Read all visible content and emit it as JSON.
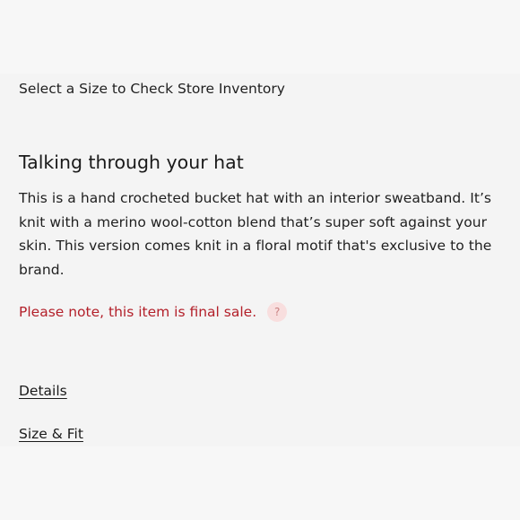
{
  "store_inventory_label": "Select a Size to Check Store Inventory",
  "section_title": "Talking through your hat",
  "description": "This is a hand crocheted bucket hat with an interior sweatband. It’s knit with a merino wool-cotton blend that’s super soft against your skin. This version comes knit in a floral motif that's exclusive to the brand.",
  "final_sale_note": "Please note, this item is final sale.",
  "help_icon_glyph": "?",
  "links": {
    "details": "Details",
    "size_fit": "Size & Fit"
  },
  "colors": {
    "background": "#f4f4f4",
    "text": "#1c1c1c",
    "final_sale": "#b3202a",
    "help_icon_bg": "#f8dede"
  }
}
